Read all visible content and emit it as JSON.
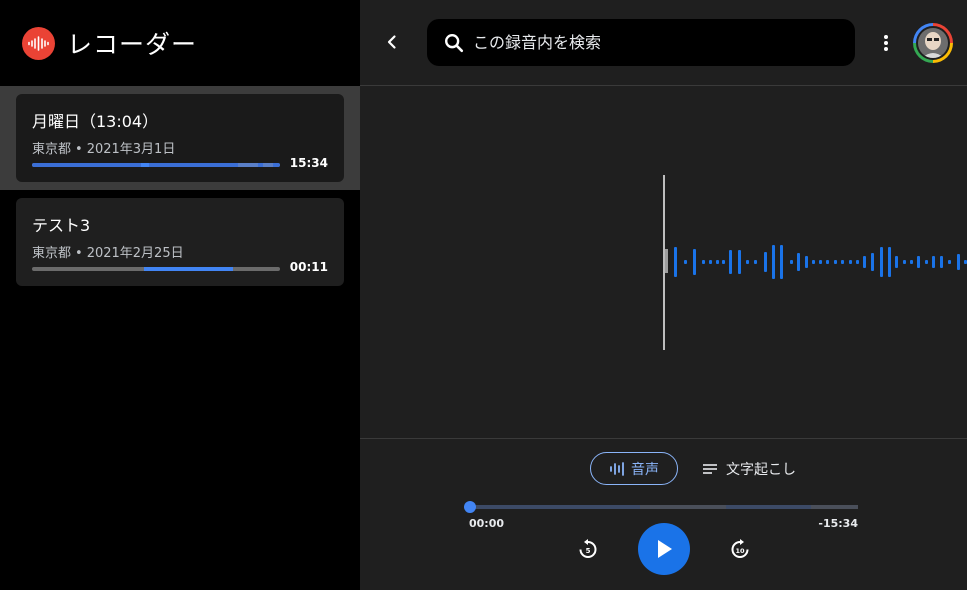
{
  "app": {
    "title": "レコーダー"
  },
  "recordings": [
    {
      "title": "月曜日（13:04）",
      "location": "東京都",
      "date": "2021年3月1日",
      "duration": "15:34",
      "active": true
    },
    {
      "title": "テスト3",
      "location": "東京都",
      "date": "2021年2月25日",
      "duration": "00:11",
      "active": false
    }
  ],
  "search": {
    "placeholder": "この録音内を検索"
  },
  "tabs": {
    "audio": "音声",
    "transcript": "文字起こし"
  },
  "player": {
    "current": "00:00",
    "remaining": "-15:34",
    "progress": 0
  },
  "icons": {
    "back": "chevron-left-icon",
    "search": "search-icon",
    "more": "more-vert-icon",
    "audio_tab": "waveform-icon",
    "transcript_tab": "lines-icon",
    "rewind": "replay-5-icon",
    "play": "play-icon",
    "forward": "forward-10-icon"
  },
  "colors": {
    "accent": "#4285f4",
    "play": "#1a73e8",
    "logo": "#ea4335",
    "tab_border": "#8ab4f8"
  }
}
